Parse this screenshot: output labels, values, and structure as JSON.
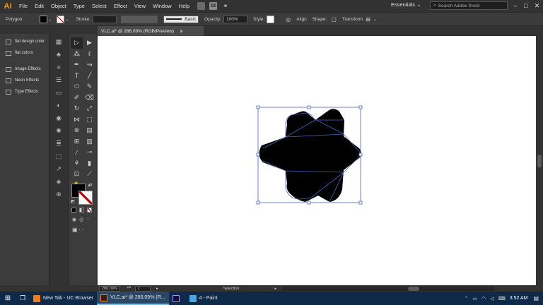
{
  "menubar": {
    "logo": "Ai",
    "items": [
      "File",
      "Edit",
      "Object",
      "Type",
      "Select",
      "Effect",
      "View",
      "Window",
      "Help"
    ],
    "stock_btn": "St",
    "workspace": "Essentials",
    "search_placeholder": "Search Adobe Stock"
  },
  "controlbar": {
    "object_type": "Polygon",
    "stroke_label": "Stroke:",
    "brush": "Basic",
    "opacity_label": "Opacity:",
    "opacity_value": "100%",
    "style_label": "Style:",
    "align_label": "Align",
    "shape_label": "Shape:",
    "transform_label": "Transform"
  },
  "document": {
    "tab_title": "VLC.ai* @ 286.09% (RGB/Preview)",
    "close_icon": "×"
  },
  "panels": {
    "items": [
      {
        "label": "flat design color"
      },
      {
        "label": "flat colors"
      },
      {
        "label": "Image Effects"
      },
      {
        "label": "Neon Effects"
      },
      {
        "label": "Type Effects"
      }
    ]
  },
  "status": {
    "zoom": "286.09%",
    "page": "1",
    "tool": "Selection"
  },
  "taskbar": {
    "apps": [
      {
        "label": "New Tab - UC Browser",
        "icon": "uc-browser-icon",
        "color": "#f07c1c"
      },
      {
        "label": "VLC.ai* @ 286.09% (R...",
        "icon": "illustrator-icon",
        "color": "#ff7f18",
        "active": true
      },
      {
        "label": "",
        "icon": "premiere-icon",
        "color": "#9999ff"
      },
      {
        "label": "4 - Paint",
        "icon": "paint-icon",
        "color": "#4aa6e0"
      }
    ],
    "time": "3:52 AM"
  }
}
